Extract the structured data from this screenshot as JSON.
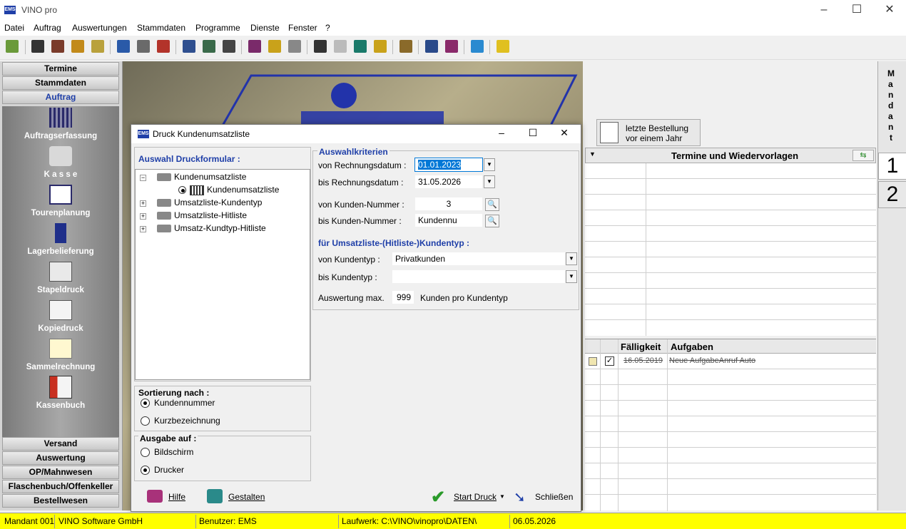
{
  "app": {
    "title": "VINO pro",
    "icon_text": "EMS"
  },
  "window_controls": {
    "minimize": "–",
    "maximize": "☐",
    "close": "✕"
  },
  "menu": [
    "Datei",
    "Auftrag",
    "Auswertungen",
    "Stammdaten",
    "Programme",
    "Dienste",
    "Fenster",
    "?"
  ],
  "sidebar": {
    "top_heads": [
      "Termine",
      "Stammdaten",
      "Auftrag"
    ],
    "items": [
      "Auftragserfassung",
      "K a s s e",
      "Tourenplanung",
      "Lagerbelieferung",
      "Stapeldruck",
      "Kopiedruck",
      "Sammelrechnung",
      "Kassenbuch"
    ],
    "bottom_heads": [
      "Versand",
      "Auswertung",
      "OP/Mahnwesen",
      "Flaschenbuch/Offenkeller",
      "Bestellwesen"
    ]
  },
  "dialog": {
    "icon_text": "EMS",
    "title": "Druck Kundenumsatzliste",
    "form_title": "Auswahl Druckformular :",
    "tree": [
      {
        "label": "Kundenumsatzliste",
        "expander": "−"
      },
      {
        "label": "Kundenumsatzliste",
        "expander": ""
      },
      {
        "label": "Umsatzliste-Kundentyp",
        "expander": "+"
      },
      {
        "label": "Umsatzliste-Hitliste",
        "expander": "+"
      },
      {
        "label": "Umsatz-Kundtyp-Hitliste",
        "expander": "+"
      }
    ],
    "criteria_title": "Auswahlkriterien",
    "von_datum_label": "von Rechnungsdatum :",
    "von_datum": "01.01.2023",
    "bis_datum_label": "bis Rechnungsdatum :",
    "bis_datum": "31.05.2026",
    "von_kunde_label": "von Kunden-Nummer :",
    "von_kunde": "3",
    "bis_kunde_label": "bis Kunden-Nummer :",
    "bis_kunde": "Kundennu",
    "kundentyp_title": "für Umsatzliste-(Hitliste-)Kundentyp :",
    "von_typ_label": "von Kundentyp :",
    "von_typ": "Privatkunden",
    "bis_typ_label": "bis Kundentyp :",
    "bis_typ": "",
    "max_label": "Auswertung max.",
    "max_value": "999",
    "max_suffix": "Kunden pro Kundentyp",
    "sort_title": "Sortierung nach :",
    "sort_options": [
      "Kundennummer",
      "Kurzbezeichnung"
    ],
    "sort_selected": 0,
    "output_title": "Ausgabe auf :",
    "output_options": [
      "Bildschirm",
      "Drucker"
    ],
    "output_selected": 1,
    "buttons": {
      "help": "Hilfe",
      "design": "Gestalten",
      "print": "Start Druck",
      "close": "Schließen"
    }
  },
  "right": {
    "last_order_line1": "letzte Bestellung",
    "last_order_line2": "vor einem Jahr",
    "termine_title": "Termine und Wiedervorlagen",
    "tasks_col1": "Fälligkeit",
    "tasks_col2": "Aufgaben",
    "task_date": "16.05.2019",
    "task_text": "Neue AufgabeAnruf Auto"
  },
  "mandant": {
    "letters": [
      "M",
      "a",
      "n",
      "d",
      "a",
      "n",
      "t"
    ],
    "tabs": [
      "1",
      "2"
    ]
  },
  "status": {
    "mandant": "Mandant 001",
    "company": "VINO Software GmbH",
    "user": "Benutzer: EMS",
    "drive": "Laufwerk: C:\\VINO\\vinopro\\DATEN\\",
    "date": "06.05.2026"
  }
}
